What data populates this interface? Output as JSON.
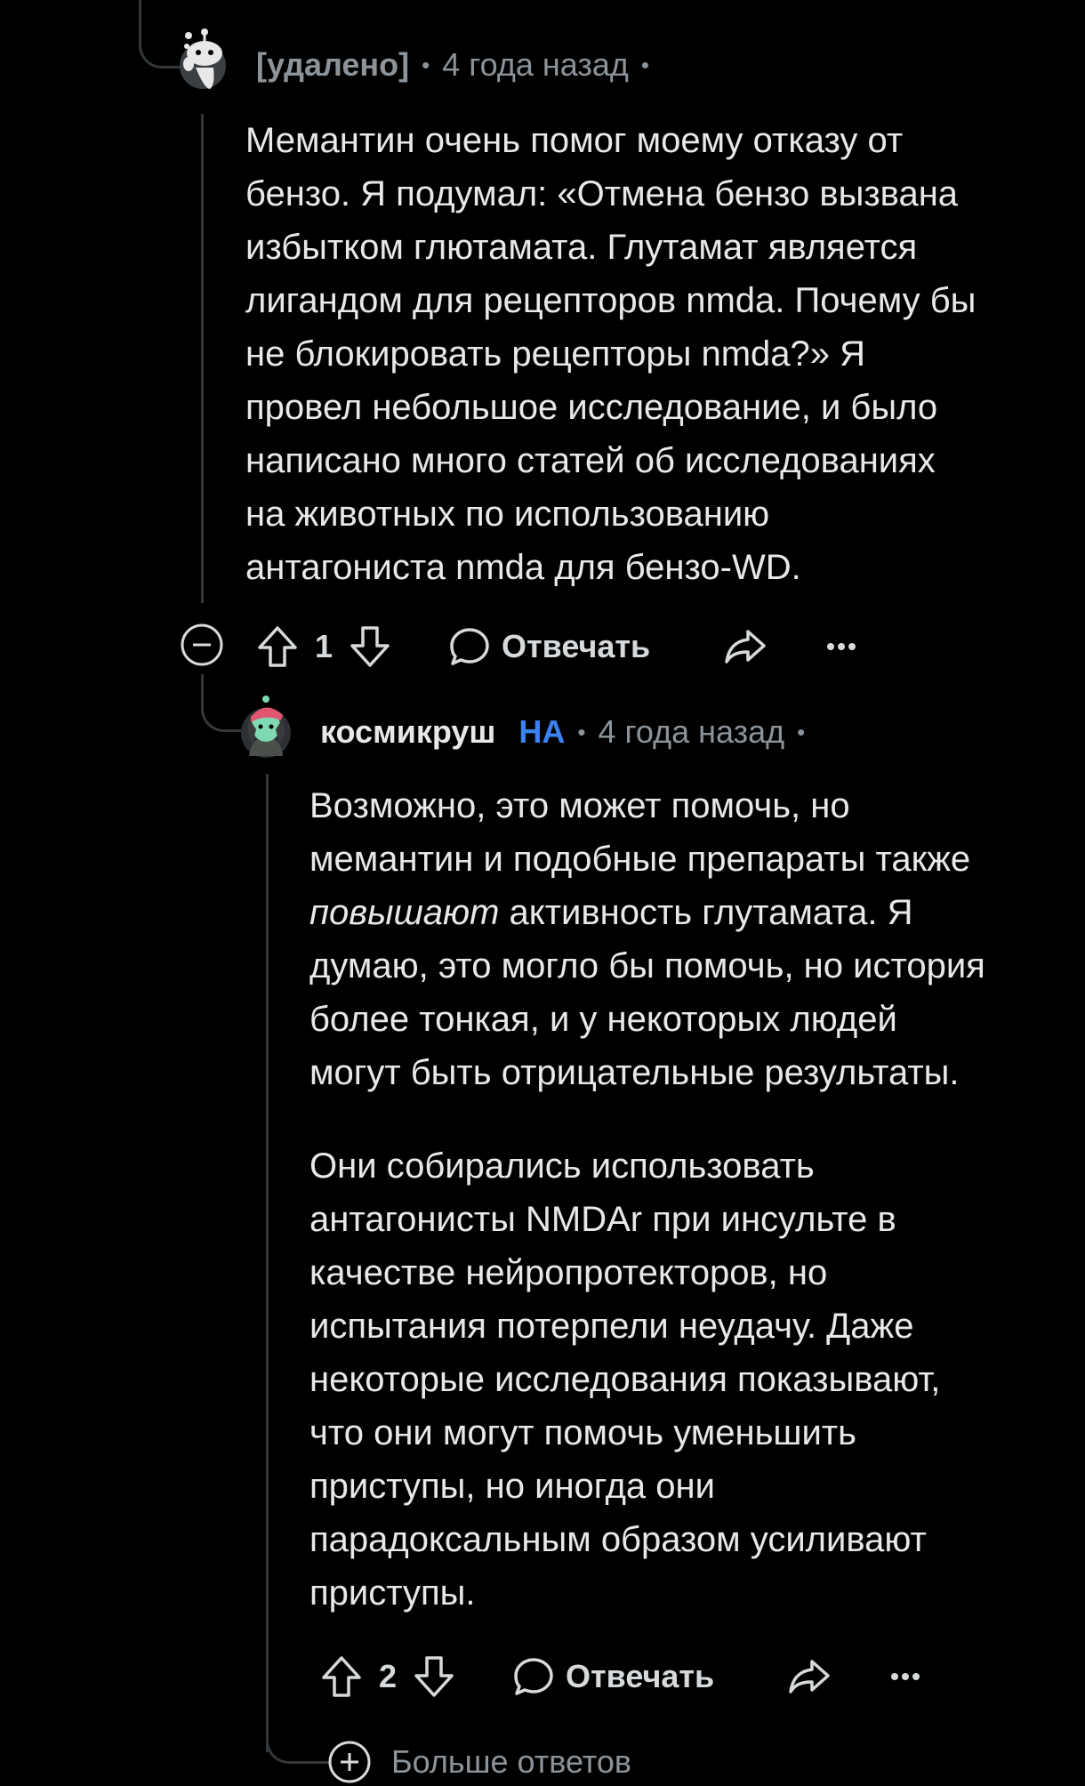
{
  "comment1": {
    "author": "[удалено]",
    "time": "4 года назад",
    "paragraphs": [
      [
        "Мемантин очень помог моему отказу от",
        "бензо. Я подумал: «Отмена бензо вызвана",
        "избытком глютамата. Глутамат является",
        "лигандом для рецепторов nmda. Почему бы",
        "не блокировать рецепторы nmda?» Я",
        "провел небольшое исследование, и было",
        "написано много статей об исследованиях",
        "на животных по использованию",
        "антагониста nmda для бензо-WD."
      ]
    ],
    "votes": "1",
    "reply_label": "Отвечать"
  },
  "comment2": {
    "author": "космикруш",
    "flair": "НА",
    "time": "4 года назад",
    "line1": "Возможно, это может помочь, но",
    "line2": "мемантин и подобные препараты также",
    "line3_em": "повышают",
    "line3_rest": " активность глутамата. Я",
    "line4": "думаю, это могло бы помочь, но история",
    "line5": "более тонкая, и у некоторых людей",
    "line6": "могут быть отрицательные результаты.",
    "para2": [
      "Они собирались использовать",
      "антагонисты NMDAr при инсульте в",
      "качестве нейропротекторов, но",
      "испытания потерпели неудачу. Даже",
      "некоторые исследования показывают,",
      "что они могут помочь уменьшить",
      "приступы, но иногда они",
      "парадоксальным образом усиливают",
      "приступы."
    ],
    "votes": "2",
    "reply_label": "Отвечать"
  },
  "more_replies_label": "Больше ответов",
  "colors": {
    "background": "#000000",
    "text": "#e6e8ea",
    "muted": "#8c9399",
    "flair": "#3b82f6",
    "thread_line": "#33383c"
  }
}
